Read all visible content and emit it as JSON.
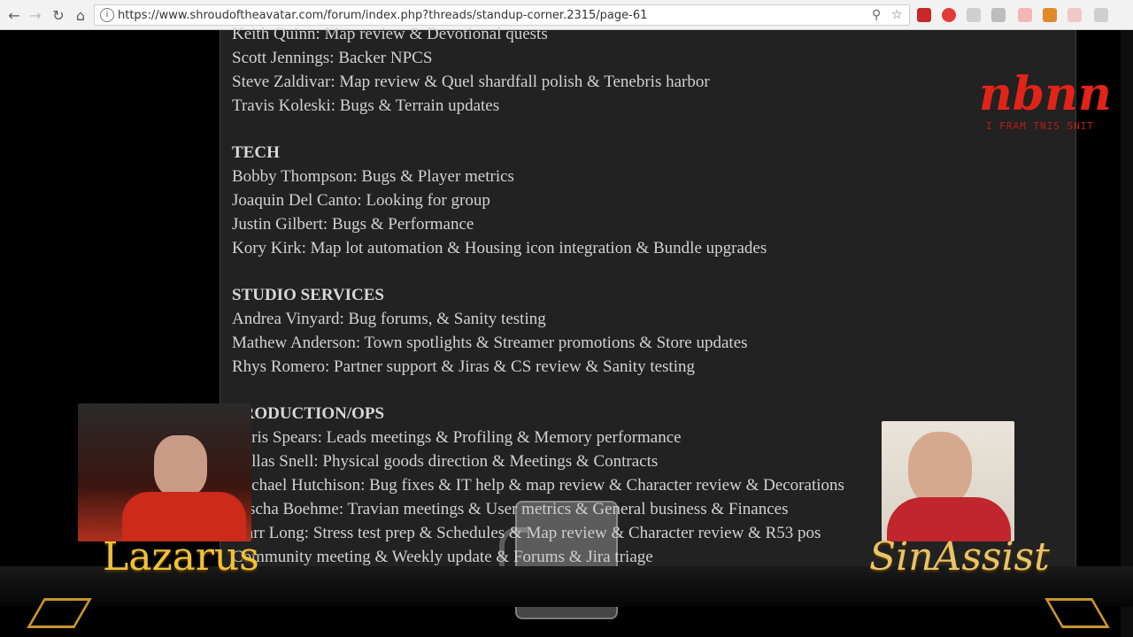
{
  "browser": {
    "url": "https://www.shroudoftheavatar.com/forum/index.php?threads/standup-corner.2315/page-61",
    "back_icon": "arrow-left-icon",
    "forward_icon": "arrow-right-icon",
    "reload_icon": "reload-icon",
    "home_icon": "home-icon"
  },
  "content": {
    "partial_lines": [
      "Keith Quinn: Map review & Devotional quests",
      "Scott Jennings: Backer NPCS",
      "Steve Zaldivar: Map review & Quel shardfall polish & Tenebris harbor",
      "Travis Koleski: Bugs & Terrain updates"
    ],
    "sections": [
      {
        "header": "TECH",
        "lines": [
          "Bobby Thompson: Bugs & Player metrics",
          "Joaquin Del Canto: Looking for group",
          "Justin Gilbert: Bugs & Performance",
          "Kory Kirk: Map lot automation & Housing icon integration & Bundle upgrades"
        ]
      },
      {
        "header": "STUDIO SERVICES",
        "lines": [
          "Andrea Vinyard: Bug forums, & Sanity testing",
          "Mathew Anderson: Town spotlights & Streamer promotions & Store updates",
          "Rhys Romero: Partner support & Jiras & CS review & Sanity testing"
        ]
      },
      {
        "header": "PRODUCTION/OPS",
        "lines": [
          "Chris Spears: Leads meetings & Profiling & Memory performance",
          "Dallas Snell: Physical goods direction & Meetings & Contracts",
          "Michael Hutchison: Bug fixes & IT help & map review & Character review & Decorations",
          "Sascha Boehme: Travian meetings & User metrics & General business & Finances",
          "Starr Long: Stress test prep & Schedules & Map review & Character review & R53 pos",
          "Community meeting & Weekly update & Forums & Jira triage"
        ]
      }
    ]
  },
  "overlay": {
    "left_name": "Lazarus",
    "right_name": "SinAssist",
    "logo_text": "nbnn",
    "logo_subtext": "I FRAM TNIS SNIT"
  },
  "colors": {
    "panel": "#222222",
    "text": "#d2d2d2",
    "gold": "#f0c23a",
    "logo_red": "#e2231a"
  }
}
